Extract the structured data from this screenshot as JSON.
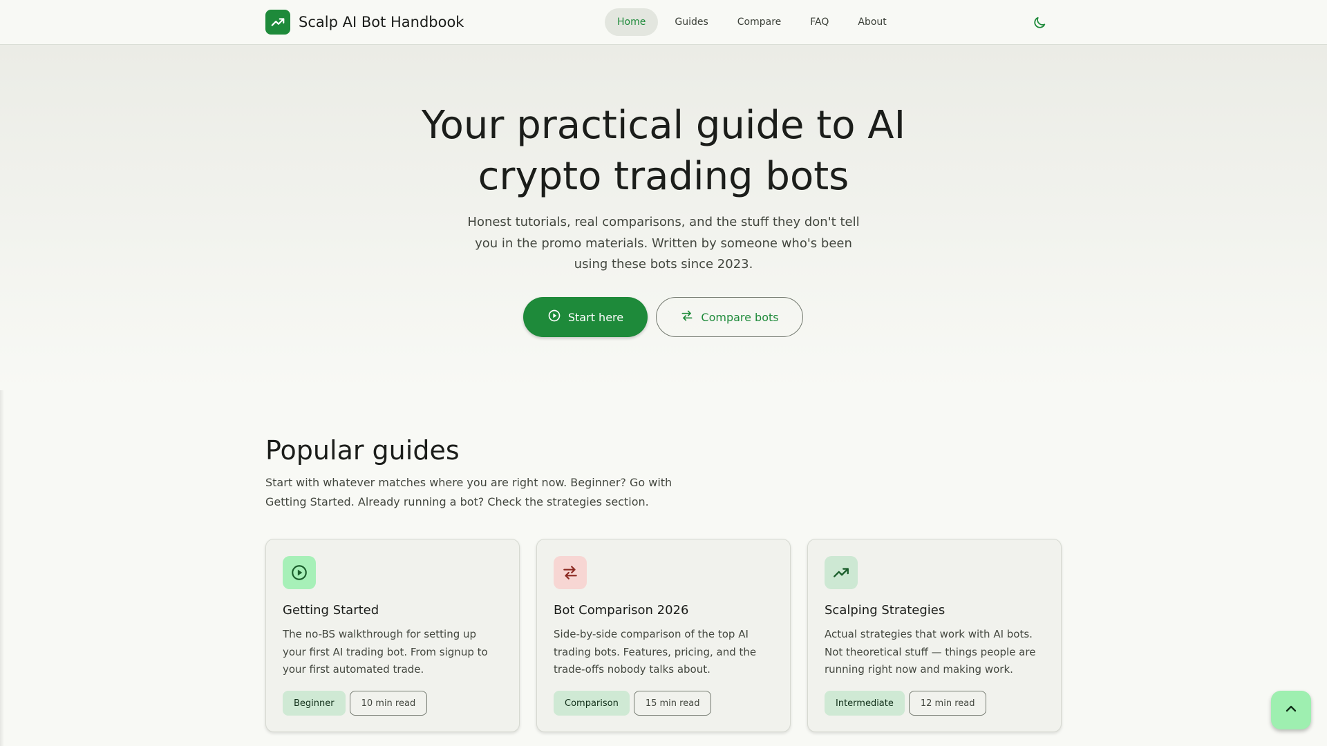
{
  "header": {
    "brand_title": "Scalp AI Bot Handbook",
    "brand_icon": "trending-up-icon",
    "nav": [
      {
        "label": "Home",
        "active": true
      },
      {
        "label": "Guides",
        "active": false
      },
      {
        "label": "Compare",
        "active": false
      },
      {
        "label": "FAQ",
        "active": false
      },
      {
        "label": "About",
        "active": false
      }
    ],
    "theme_icon": "dark-mode-icon"
  },
  "hero": {
    "title_line1": "Your practical guide to AI",
    "title_line2": "crypto trading bots",
    "subtitle": "Honest tutorials, real comparisons, and the stuff they don't tell you in the promo materials. Written by someone who's been using these bots since 2023.",
    "primary_button": {
      "label": "Start here",
      "icon": "play-circle-icon"
    },
    "secondary_button": {
      "label": "Compare bots",
      "icon": "compare-icon"
    }
  },
  "guides": {
    "title": "Popular guides",
    "subtitle": "Start with whatever matches where you are right now. Beginner? Go with Getting Started. Already running a bot? Check the strategies section.",
    "cards": [
      {
        "icon": "play-circle-icon",
        "icon_bg": "#a7f0b8",
        "title": "Getting Started",
        "description": "The no-BS walkthrough for setting up your first AI trading bot. From signup to your first automated trade.",
        "level": "Beginner",
        "read_time": "10 min read"
      },
      {
        "icon": "compare-icon",
        "icon_bg": "#f7d6d3",
        "title": "Bot Comparison 2026",
        "description": "Side-by-side comparison of the top AI trading bots. Features, pricing, and the trade-offs nobody talks about.",
        "level": "Comparison",
        "read_time": "15 min read"
      },
      {
        "icon": "trending-up-icon",
        "icon_bg": "#cde8d3",
        "title": "Scalping Strategies",
        "description": "Actual strategies that work with AI bots. Not theoretical stuff — things people are running right now and making work.",
        "level": "Intermediate",
        "read_time": "12 min read"
      }
    ]
  },
  "scroll_top_icon": "keyboard-arrow-up-icon",
  "colors": {
    "accent": "#1e8a3a",
    "background": "#f8f9f5",
    "fab": "#9eefb0"
  }
}
